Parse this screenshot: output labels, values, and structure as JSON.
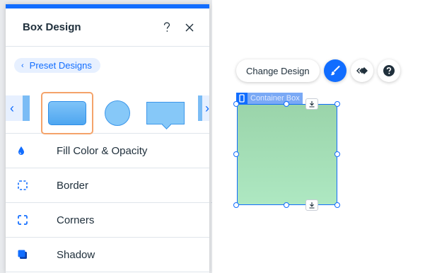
{
  "panel": {
    "title": "Box Design",
    "help_icon": "question-icon",
    "close_icon": "close-icon",
    "preset_designs_label": "Preset Designs",
    "presets": [
      {
        "name": "rounded-rectangle",
        "selected": true
      },
      {
        "name": "circle",
        "selected": false
      },
      {
        "name": "speech-bubble",
        "selected": false
      }
    ],
    "menu": [
      {
        "label": "Fill Color & Opacity",
        "icon": "drop-icon"
      },
      {
        "label": "Border",
        "icon": "dashed-square-icon"
      },
      {
        "label": "Corners",
        "icon": "corners-icon"
      },
      {
        "label": "Shadow",
        "icon": "shadow-icon"
      }
    ]
  },
  "toolbar": {
    "change_design_label": "Change Design",
    "buttons": [
      "brush-icon",
      "animation-icon",
      "help-icon"
    ]
  },
  "element": {
    "label": "Container Box"
  },
  "colors": {
    "accent": "#116dff",
    "selected_preset_border": "#f4a36a",
    "box_fill_top": "#9ad4aa",
    "box_fill_bottom": "#aee8c2"
  }
}
